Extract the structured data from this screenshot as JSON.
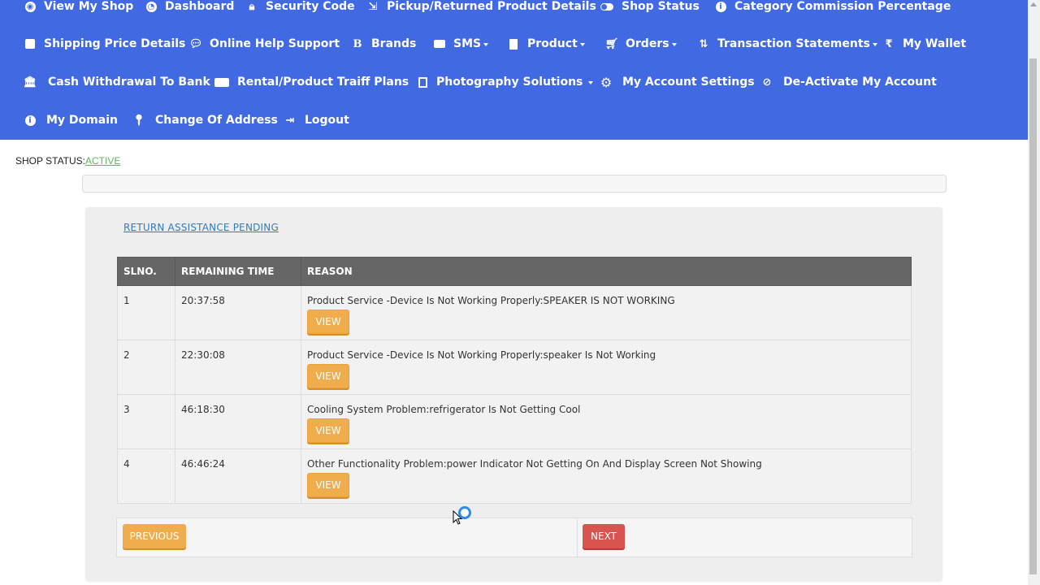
{
  "nav": {
    "row1": [
      {
        "label": "View My Shop",
        "icon": "globe-icon"
      },
      {
        "label": "Dashboard",
        "icon": "dashboard-icon"
      },
      {
        "label": "Security Code",
        "icon": "lock-icon"
      },
      {
        "label": "Pickup/Returned Product Details",
        "icon": "return-icon"
      },
      {
        "label": "Shop Status",
        "icon": "toggle-icon"
      },
      {
        "label": "Category Commission Percentage",
        "icon": "info-icon"
      }
    ],
    "row2": [
      {
        "label": "Shipping Price Details",
        "icon": "tag-icon"
      },
      {
        "label": "Online Help Support",
        "icon": "chat-icon"
      },
      {
        "label": "Brands",
        "icon": "bold-b-icon"
      },
      {
        "label": "SMS",
        "icon": "comment-icon"
      },
      {
        "label": "Product",
        "icon": "file-icon"
      },
      {
        "label": "Orders",
        "icon": "cart-icon"
      },
      {
        "label": "Transaction Statements",
        "icon": "sort-icon"
      },
      {
        "label": "My Wallet",
        "icon": "rupee-icon"
      }
    ],
    "row3": [
      {
        "label": "Cash Withdrawal To Bank",
        "icon": "bank-icon"
      },
      {
        "label": "Rental/Product Traiff Plans",
        "icon": "credit-card-icon"
      },
      {
        "label": "Photography Solutions",
        "icon": "image-file-icon"
      },
      {
        "label": "My Account Settings",
        "icon": "gear-icon"
      },
      {
        "label": "De-Activate My Account",
        "icon": "ban-icon"
      }
    ],
    "row4": [
      {
        "label": "My Domain",
        "icon": "info-icon"
      },
      {
        "label": "Change Of Address",
        "icon": "map-marker-icon"
      },
      {
        "label": "Logout",
        "icon": "sign-out-icon"
      }
    ]
  },
  "shop_status": {
    "label": "SHOP STATUS:",
    "value": "ACTIVE"
  },
  "section_title": "RETURN ASSISTANCE PENDING",
  "table": {
    "headers": [
      "SLNO.",
      "REMAINING TIME",
      "REASON"
    ],
    "rows": [
      {
        "slno": "1",
        "time": "20:37:58",
        "reason": "Product Service -Device Is Not Working Properly:SPEAKER IS NOT WORKING",
        "action": "VIEW"
      },
      {
        "slno": "2",
        "time": "22:30:08",
        "reason": "Product Service -Device Is Not Working Properly:speaker Is Not Working",
        "action": "VIEW"
      },
      {
        "slno": "3",
        "time": "46:18:30",
        "reason": "Cooling System Problem:refrigerator Is Not Getting Cool",
        "action": "VIEW"
      },
      {
        "slno": "4",
        "time": "46:46:24",
        "reason": "Other Functionality Problem:power Indicator Not Getting On And Display Screen Not Showing",
        "action": "VIEW"
      }
    ]
  },
  "pager": {
    "previous": "PREVIOUS",
    "next": "NEXT"
  },
  "colors": {
    "nav_bg": "#4169e1",
    "view_btn": "#f0ad4e",
    "next_btn": "#d9534f",
    "header_bg": "#666666",
    "active": "#5cb85c"
  }
}
